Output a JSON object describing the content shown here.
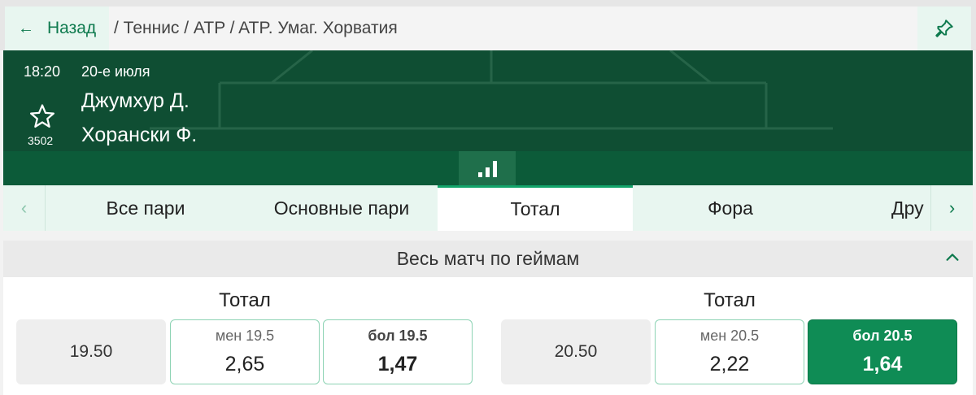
{
  "topbar": {
    "back_label": "Назад",
    "breadcrumb": "/ Теннис / ATP / ATP. Умаг. Хорватия"
  },
  "match": {
    "time": "18:20",
    "date": "20-е июля",
    "player1": "Джумхур Д.",
    "player2": "Хорански Ф.",
    "favorites_count": "3502"
  },
  "tabs": {
    "items": [
      {
        "label": "Все пари"
      },
      {
        "label": "Основные пари"
      },
      {
        "label": "Тотал"
      },
      {
        "label": "Фора"
      },
      {
        "label": "Дру"
      }
    ],
    "active": "Тотал"
  },
  "section": {
    "title": "Весь матч по геймам",
    "groups": [
      {
        "title": "Тотал",
        "base": "19.50",
        "under": {
          "label": "мен 19.5",
          "odds": "2,65"
        },
        "over": {
          "label": "бол 19.5",
          "odds": "1,47"
        }
      },
      {
        "title": "Тотал",
        "base": "20.50",
        "under": {
          "label": "мен 20.5",
          "odds": "2,22"
        },
        "over": {
          "label": "бол 20.5",
          "odds": "1,64",
          "selected": true
        }
      }
    ]
  },
  "colors": {
    "accent": "#0e7a4e",
    "header_bg": "#0f4e33",
    "selected_bg": "#0f8c55",
    "odd_border": "#8dd3b4"
  }
}
